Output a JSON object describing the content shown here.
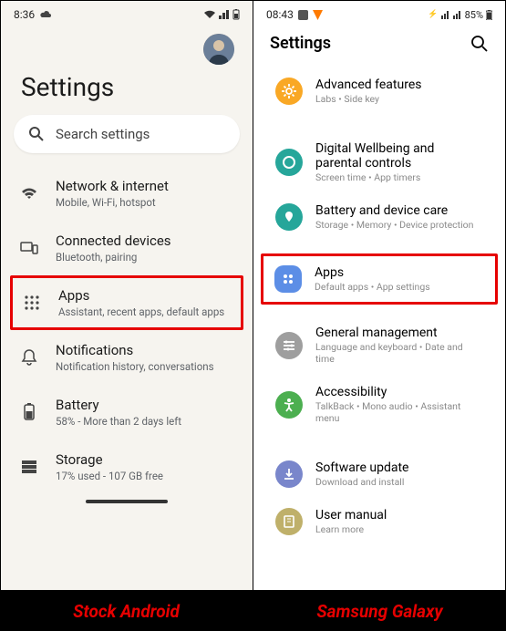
{
  "left": {
    "status": {
      "time": "8:36"
    },
    "title": "Settings",
    "search_placeholder": "Search settings",
    "items": [
      {
        "label": "Network & internet",
        "sub": "Mobile, Wi-Fi, hotspot"
      },
      {
        "label": "Connected devices",
        "sub": "Bluetooth, pairing"
      },
      {
        "label": "Apps",
        "sub": "Assistant, recent apps, default apps"
      },
      {
        "label": "Notifications",
        "sub": "Notification history, conversations"
      },
      {
        "label": "Battery",
        "sub": "58% - More than 2 days left"
      },
      {
        "label": "Storage",
        "sub": "17% used - 107 GB free"
      }
    ],
    "caption": "Stock Android"
  },
  "right": {
    "status": {
      "time": "08:43",
      "battery": "85%"
    },
    "title": "Settings",
    "items": [
      {
        "label": "Advanced features",
        "sub": "Labs  •  Side key"
      },
      {
        "label": "Digital Wellbeing and parental controls",
        "sub": "Screen time  •  App timers"
      },
      {
        "label": "Battery and device care",
        "sub": "Storage  •  Memory  •  Device protection"
      },
      {
        "label": "Apps",
        "sub": "Default apps  •  App settings"
      },
      {
        "label": "General management",
        "sub": "Language and keyboard  •  Date and time"
      },
      {
        "label": "Accessibility",
        "sub": "TalkBack  •  Mono audio  •  Assistant menu"
      },
      {
        "label": "Software update",
        "sub": "Download and install"
      },
      {
        "label": "User manual",
        "sub": "Learn more"
      }
    ],
    "caption": "Samsung Galaxy",
    "colors": {
      "advanced": "#f9a825",
      "wellbeing": "#26a69a",
      "battery": "#26a69a",
      "apps": "#5c8ee6",
      "general": "#9e9e9e",
      "accessibility": "#4caf50",
      "software": "#7986cb",
      "manual": "#bfb06a"
    }
  }
}
